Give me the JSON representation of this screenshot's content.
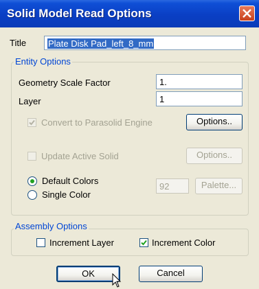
{
  "window": {
    "title": "Solid Model Read Options"
  },
  "title_field": {
    "label": "Title",
    "value": "Plate Disk Pad_left_8_mm"
  },
  "entity_options": {
    "legend": "Entity Options",
    "geometry_scale_label": "Geometry Scale Factor",
    "geometry_scale_value": "1.",
    "layer_label": "Layer",
    "layer_value": "1",
    "convert_label": "Convert to Parasolid Engine",
    "convert_checked": true,
    "convert_options_button": "Options..",
    "update_label": "Update Active Solid",
    "update_checked": false,
    "update_options_button": "Options..",
    "default_colors_label": "Default Colors",
    "single_color_label": "Single Color",
    "color_value": "92",
    "palette_button": "Palette..."
  },
  "assembly_options": {
    "legend": "Assembly Options",
    "increment_layer_label": "Increment Layer",
    "increment_layer_checked": false,
    "increment_color_label": "Increment Color",
    "increment_color_checked": true
  },
  "buttons": {
    "ok": "OK",
    "cancel": "Cancel"
  }
}
